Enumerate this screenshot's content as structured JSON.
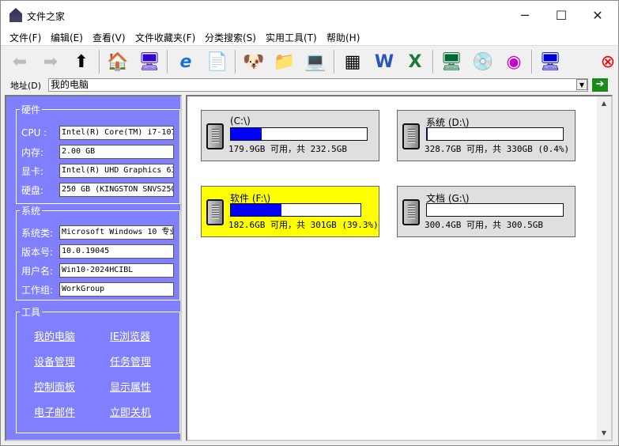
{
  "window": {
    "title": "文件之家",
    "minimize": "─",
    "maximize": "☐",
    "close": "✕"
  },
  "menu": [
    "文件(F)",
    "编辑(E)",
    "查看(V)",
    "文件收藏夹(F)",
    "分类搜索(S)",
    "实用工具(T)",
    "帮助(H)"
  ],
  "address": {
    "label": "地址(D)",
    "value": "我的电脑",
    "go": "➔"
  },
  "hardware": {
    "legend": "硬件",
    "rows": [
      {
        "label": "CPU :",
        "value": "Intel(R) Core(TM) i7-107"
      },
      {
        "label": "内存:",
        "value": "2.00 GB"
      },
      {
        "label": "显卡:",
        "value": "Intel(R) UHD Graphics 63"
      },
      {
        "label": "硬盘:",
        "value": "250 GB (KINGSTON SNVS250"
      }
    ]
  },
  "system": {
    "legend": "系统",
    "rows": [
      {
        "label": "系统类:",
        "value": "Microsoft Windows 10 专业"
      },
      {
        "label": "版本号:",
        "value": "10.0.19045"
      },
      {
        "label": "用户名:",
        "value": "Win10-2024HCIBL"
      },
      {
        "label": "工作组:",
        "value": "WorkGroup"
      }
    ]
  },
  "tools": {
    "legend": "工具",
    "links": [
      "我的电脑",
      "IE浏览器",
      "设备管理",
      "任务管理",
      "控制面板",
      "显示属性",
      "电子邮件",
      "立即关机"
    ]
  },
  "drives": [
    {
      "name": "(C:\\)",
      "info": "179.9GB 可用，共 232.5GB",
      "used_percent": 22.6,
      "selected": false
    },
    {
      "name": "系统 (D:\\)",
      "info": "328.7GB 可用，共 330GB (0.4%)",
      "used_percent": 0.4,
      "selected": false
    },
    {
      "name": "软件 (F:\\)",
      "info": "182.6GB 可用，共 301GB (39.3%)",
      "used_percent": 39.3,
      "selected": true
    },
    {
      "name": "文档 (G:\\)",
      "info": "300.4GB 可用，共 300.5GB",
      "used_percent": 0.03,
      "selected": false
    }
  ],
  "colors": {
    "panel": "#8080ff",
    "selected": "#ffff00",
    "bar": "#0000ff"
  }
}
